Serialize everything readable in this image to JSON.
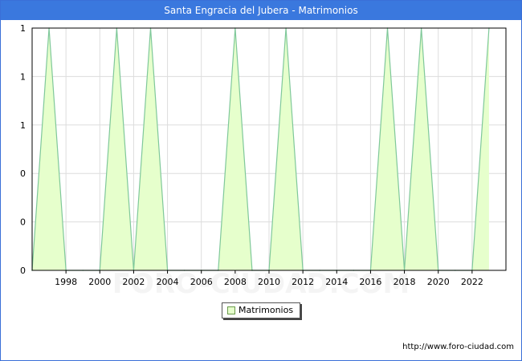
{
  "title": "Santa Engracia del Jubera - Matrimonios",
  "legend_label": "Matrimonios",
  "source": "http://www.foro-ciudad.com",
  "watermark": "FORO-CIUDAD.COM",
  "colors": {
    "title_bg": "#3a78de",
    "fill": "#e6ffcc",
    "line": "#7fc89a",
    "grid": "#dddddd"
  },
  "chart_data": {
    "type": "area",
    "title": "Santa Engracia del Jubera - Matrimonios",
    "xlabel": "",
    "ylabel": "",
    "x": [
      1996,
      1997,
      1998,
      1999,
      2000,
      2001,
      2002,
      2003,
      2004,
      2005,
      2006,
      2007,
      2008,
      2009,
      2010,
      2011,
      2012,
      2013,
      2014,
      2015,
      2016,
      2017,
      2018,
      2019,
      2020,
      2021,
      2022,
      2023
    ],
    "series": [
      {
        "name": "Matrimonios",
        "values": [
          0,
          1,
          0,
          0,
          0,
          1,
          0,
          1,
          0,
          0,
          0,
          0,
          1,
          0,
          0,
          1,
          0,
          0,
          0,
          0,
          0,
          1,
          0,
          1,
          0,
          0,
          0,
          1
        ]
      }
    ],
    "xlim": [
      1996,
      2024
    ],
    "ylim": [
      0,
      1
    ],
    "x_ticks": [
      1998,
      2000,
      2002,
      2004,
      2006,
      2008,
      2010,
      2012,
      2014,
      2016,
      2018,
      2020,
      2022
    ],
    "y_ticks": [
      0,
      0.2,
      0.4,
      0.6,
      0.8,
      1
    ],
    "y_tick_labels": [
      "0",
      "0",
      "0",
      "1",
      "1",
      "1"
    ],
    "grid": true,
    "legend_position": "bottom-center"
  }
}
